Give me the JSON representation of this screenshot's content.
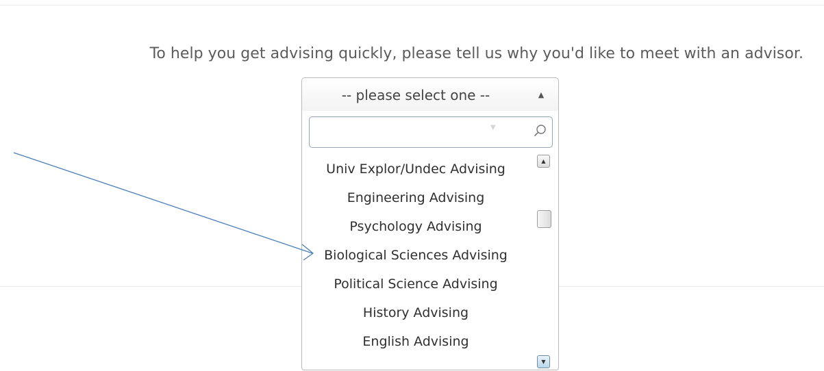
{
  "prompt": {
    "text": "To help you get advising quickly, please tell us why you'd like to meet with an advisor."
  },
  "select": {
    "value": "-- please select one --",
    "caret_glyph": "▲"
  },
  "search": {
    "value": "",
    "placeholder": ""
  },
  "options": [
    "Univ Explor/Undec Advising",
    "Engineering Advising",
    "Psychology Advising",
    "Biological Sciences Advising",
    "Political Science Advising",
    "History Advising",
    "English Advising"
  ],
  "scrollbar": {
    "up_glyph": "▲",
    "down_glyph": "▼",
    "position": 0.25
  },
  "colors": {
    "annotation_arrow": "#4a7ebb",
    "search_border": "#9aa7b6"
  }
}
